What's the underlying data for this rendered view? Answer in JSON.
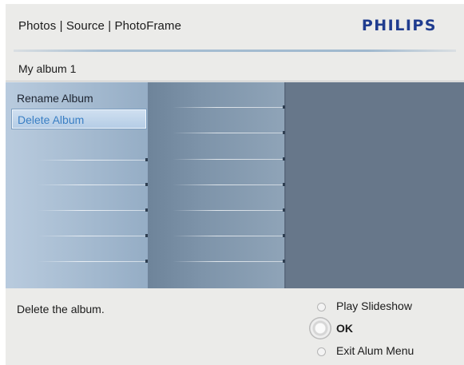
{
  "header": {
    "breadcrumb": "Photos | Source | PhotoFrame",
    "brand": "PHILIPS"
  },
  "album": {
    "title": "My album 1"
  },
  "menu": {
    "items": [
      {
        "label": "Rename Album",
        "selected": false
      },
      {
        "label": "Delete Album",
        "selected": true
      }
    ]
  },
  "footer": {
    "hint": "Delete the album.",
    "controls": [
      {
        "icon": "circle-button-icon",
        "label": "Play Slideshow"
      },
      {
        "icon": "ok-dial-icon",
        "label": "OK"
      },
      {
        "icon": "circle-button-icon",
        "label": "Exit Alum Menu"
      }
    ]
  },
  "colors": {
    "brand": "#1f3c8f",
    "background": "#ebebe9",
    "panel_light": "#b9cbde",
    "panel_mid": "#7e94aa",
    "panel_dark": "#67778a",
    "selection_text": "#3a7fc4"
  }
}
